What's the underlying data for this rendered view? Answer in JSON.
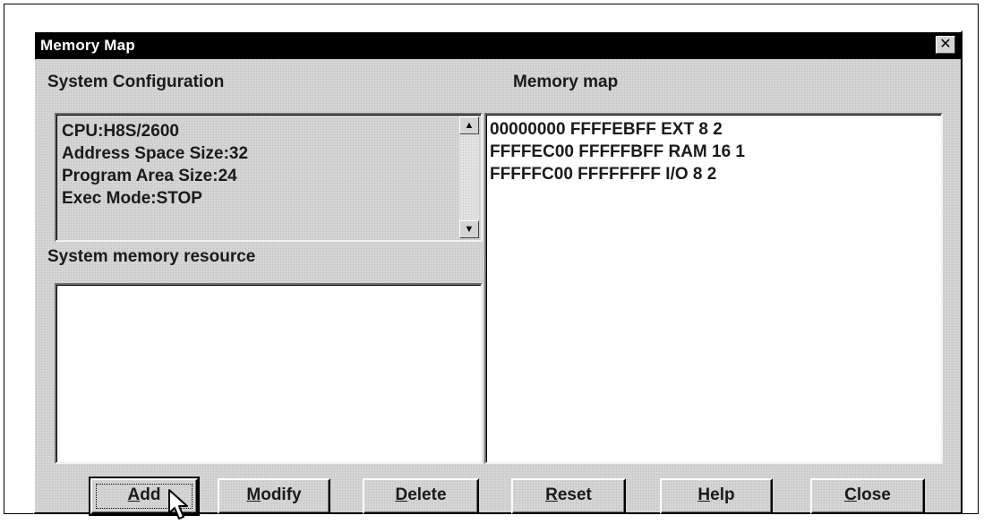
{
  "window": {
    "title": "Memory Map",
    "close_glyph": "✕"
  },
  "labels": {
    "system_configuration": "System Configuration",
    "memory_map": "Memory map",
    "system_memory_resource": "System memory resource"
  },
  "system_configuration": {
    "lines": [
      "CPU:H8S/2600",
      "Address Space Size:32",
      "Program Area Size:24",
      "Exec Mode:STOP"
    ]
  },
  "memory_map": {
    "entries": [
      "00000000 FFFFEBFF EXT 8 2",
      "FFFFEC00 FFFFFBFF RAM 16 1",
      "FFFFFC00 FFFFFFFF I/O 8 2"
    ]
  },
  "system_memory_resource": {
    "entries": []
  },
  "buttons": {
    "add": {
      "mnemonic": "A",
      "rest": "dd"
    },
    "modify": {
      "mnemonic": "M",
      "rest": "odify"
    },
    "delete": {
      "mnemonic": "D",
      "rest": "elete"
    },
    "reset": {
      "mnemonic": "R",
      "rest": "eset"
    },
    "help": {
      "mnemonic": "H",
      "rest": "elp"
    },
    "close": {
      "mnemonic": "C",
      "rest": "lose"
    }
  },
  "icons": {
    "scroll_up": "▲",
    "scroll_down": "▼",
    "cursor": "arrow-cursor-icon"
  }
}
